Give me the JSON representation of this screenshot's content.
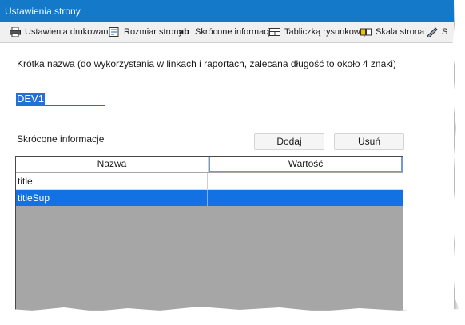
{
  "window": {
    "title": "Ustawienia strony"
  },
  "tabs": [
    {
      "label": "Ustawienia drukowania",
      "icon": "printer-icon"
    },
    {
      "label": "Rozmiar strony",
      "icon": "page-size-icon"
    },
    {
      "label": "Skrócone informacje",
      "icon": "ab-text-icon",
      "icon_text": "ab",
      "active": true
    },
    {
      "label": "Tabliczką rysunkową",
      "icon": "title-block-icon"
    },
    {
      "label": "Skala strona",
      "icon": "scale-icon"
    },
    {
      "label": "S",
      "icon": "pencil-ruler-icon"
    }
  ],
  "short_name": {
    "description": "Krótka nazwa (do wykorzystania w linkach i raportach, zalecana długość to około 4 znaki)",
    "value": "DEV1"
  },
  "short_info": {
    "label": "Skrócone informacje",
    "add_label": "Dodaj",
    "remove_label": "Usuń",
    "columns": [
      "Nazwa",
      "Wartość"
    ],
    "rows": [
      {
        "name": "title",
        "value": ""
      },
      {
        "name": "titleSup",
        "value": "",
        "selected": true
      }
    ]
  },
  "colors": {
    "titlebar": "#1479c9",
    "selection": "#1271e3",
    "grid_empty": "#a6a6a6"
  }
}
